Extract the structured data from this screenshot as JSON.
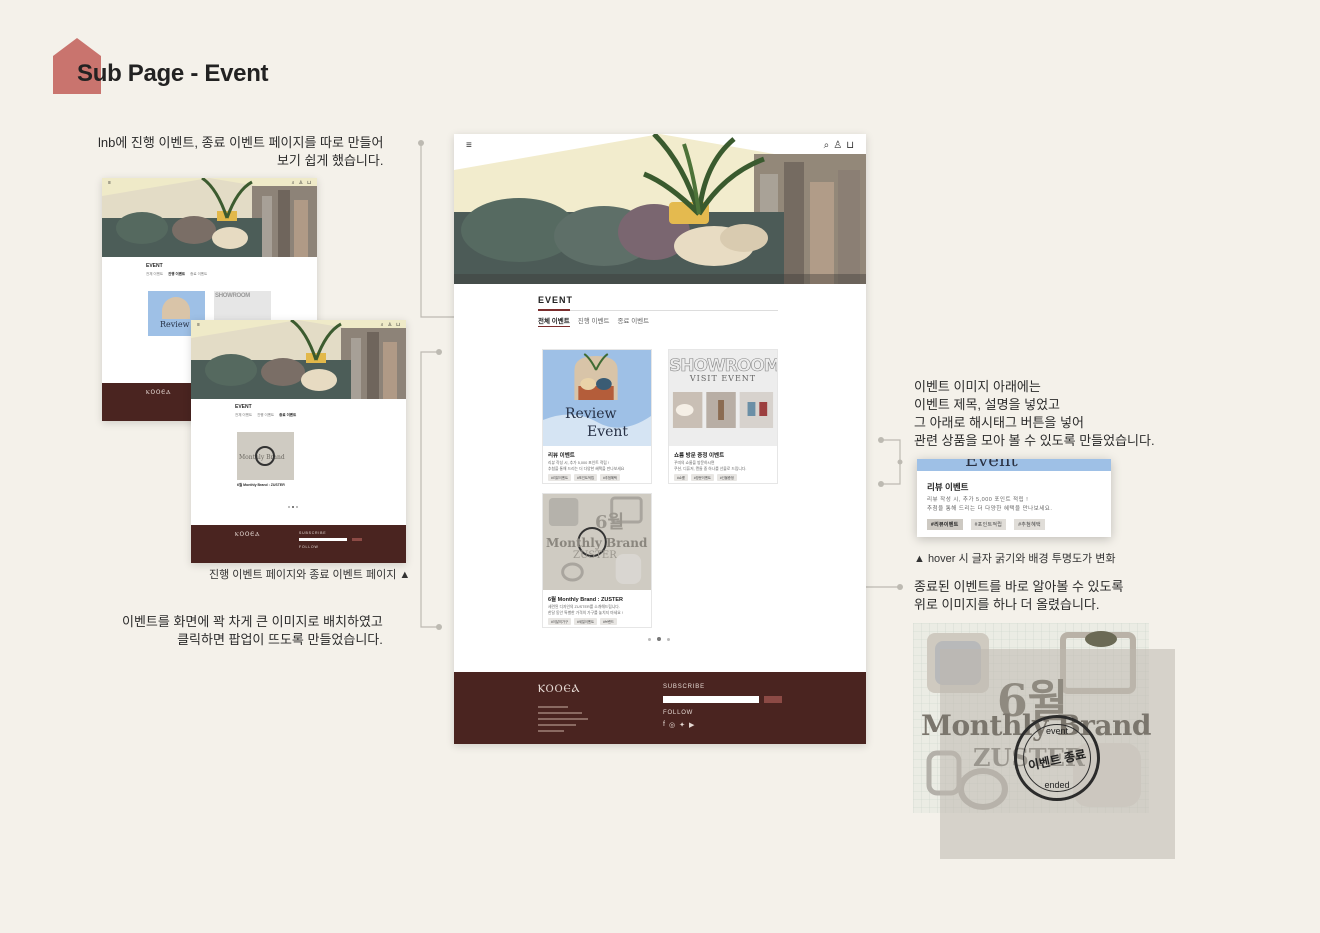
{
  "page_title": "Sub Page - Event",
  "notes": {
    "lnb": [
      "lnb에 진행 이벤트, 종료 이벤트 페이지를 따로 만들어",
      "보기 쉽게 했습니다."
    ],
    "image": [
      "이벤트를 화면에 꽉 차게 큰 이미지로 배치하였고",
      "클릭하면 팝업이 뜨도록 만들었습니다."
    ],
    "desc": [
      "이벤트 이미지 아래에는",
      "이벤트 제목, 설명을 넣었고",
      "그 아래로  해시태그 버튼을 넣어",
      "관련 상품을 모아 볼 수 있도록 만들었습니다."
    ],
    "ended": [
      "종료된 이벤트를 바로 알아볼 수 있도록",
      "위로 이미지를 하나 더 올렸습니다."
    ]
  },
  "captions": {
    "pages": "진행 이벤트 페이지와 종료 이벤트 페이지 ▲",
    "hover": "▲ hover 시 글자 굵기와 배경 투명도가 변화"
  },
  "site": {
    "menu_icon": "≡",
    "event_heading": "EVENT",
    "tabs": [
      "전체 이벤트",
      "진행 이벤트",
      "종료 이벤트"
    ],
    "cards": [
      {
        "image_text": [
          "Review",
          "Event"
        ],
        "title": "리뷰 이벤트",
        "desc": [
          "리뷰 작성 시, 추가 5,000 포인트 적립 !",
          "추첨을 통해 드리는 더 다양한 혜택을 만나보세요"
        ],
        "tags": [
          "#리뷰이벤트",
          "#포인트적립",
          "#추첨혜택"
        ]
      },
      {
        "image_text": [
          "SHOWROOM",
          "VISIT EVENT"
        ],
        "title": "쇼룸 방문 증정 이벤트",
        "desc": [
          "꾸띠의 쇼룸을 방문하시면",
          "쿠션, 디퓨저, 캔들 중 하나를 선물로 드립니다."
        ],
        "tags": [
          "#쇼룸",
          "#방문이벤트",
          "#선물증정"
        ]
      },
      {
        "image_text": [
          "6월",
          "Monthly Brand",
          "ZUSTER"
        ],
        "title": "6월 Monthly Brand : ZUSTER",
        "desc": [
          "세련된 디자인의 ZUSTER를 소개해드립니다.",
          "한달 동안 특별한 가격의 가구를 놓치지 마세요 !"
        ],
        "tags": [
          "#이달의가구",
          "#세일이벤트",
          "#브랜드"
        ]
      }
    ],
    "footer": {
      "logo": "ⲔⲞⲞⲈⲀ",
      "subscribe": "SUBSCRIBE",
      "follow": "FOLLOW",
      "social_icons": [
        "facebook-icon",
        "instagram-icon",
        "twitter-icon",
        "youtube-icon"
      ]
    }
  },
  "hover_detail": {
    "band_text": "Event",
    "title": "리뷰 이벤트",
    "desc": [
      "리뷰 작성 시, 추가 5,000 포인트 적립 !",
      "추첨을 통해 드리는 더 다양한 혜택을 만나보세요."
    ],
    "tags": [
      "#리뷰이벤트",
      "#포인트적립",
      "#추첨혜택"
    ]
  },
  "ended_image": {
    "number": "6월",
    "brand": "Monthly Brand",
    "sub": "ZUSTER",
    "stamp_top": "event",
    "stamp_main": "이벤트 종료",
    "stamp_bottom": "ended"
  },
  "colors": {
    "background": "#f4f1ea",
    "accent": "#c9746e",
    "footer": "#4a2420",
    "card_blue": "#9ec0e6"
  }
}
